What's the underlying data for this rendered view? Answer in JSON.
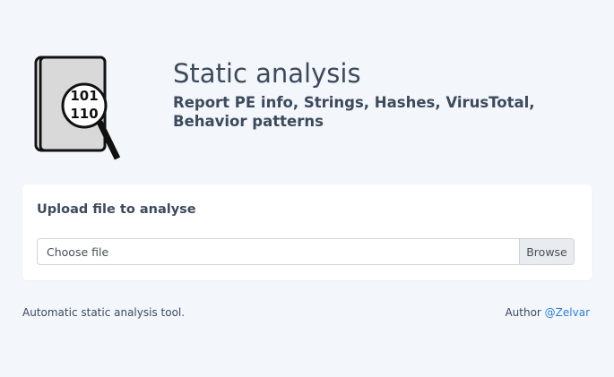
{
  "header": {
    "logo_icon": "binary-magnifier-icon",
    "logo_text_line1": "101",
    "logo_text_line2": "110",
    "title": "Static analysis",
    "subtitle": "Report PE info, Strings, Hashes, VirusTotal, Behavior patterns"
  },
  "upload": {
    "title": "Upload file to analyse",
    "file_placeholder": "Choose file",
    "browse_label": "Browse"
  },
  "footer": {
    "description": "Automatic static analysis tool.",
    "author_label": "Author",
    "author_link": "@Zelvar"
  },
  "colors": {
    "background": "#f3f6fb",
    "text": "#3d4a5c",
    "link": "#2f7ddb",
    "card": "#ffffff"
  }
}
